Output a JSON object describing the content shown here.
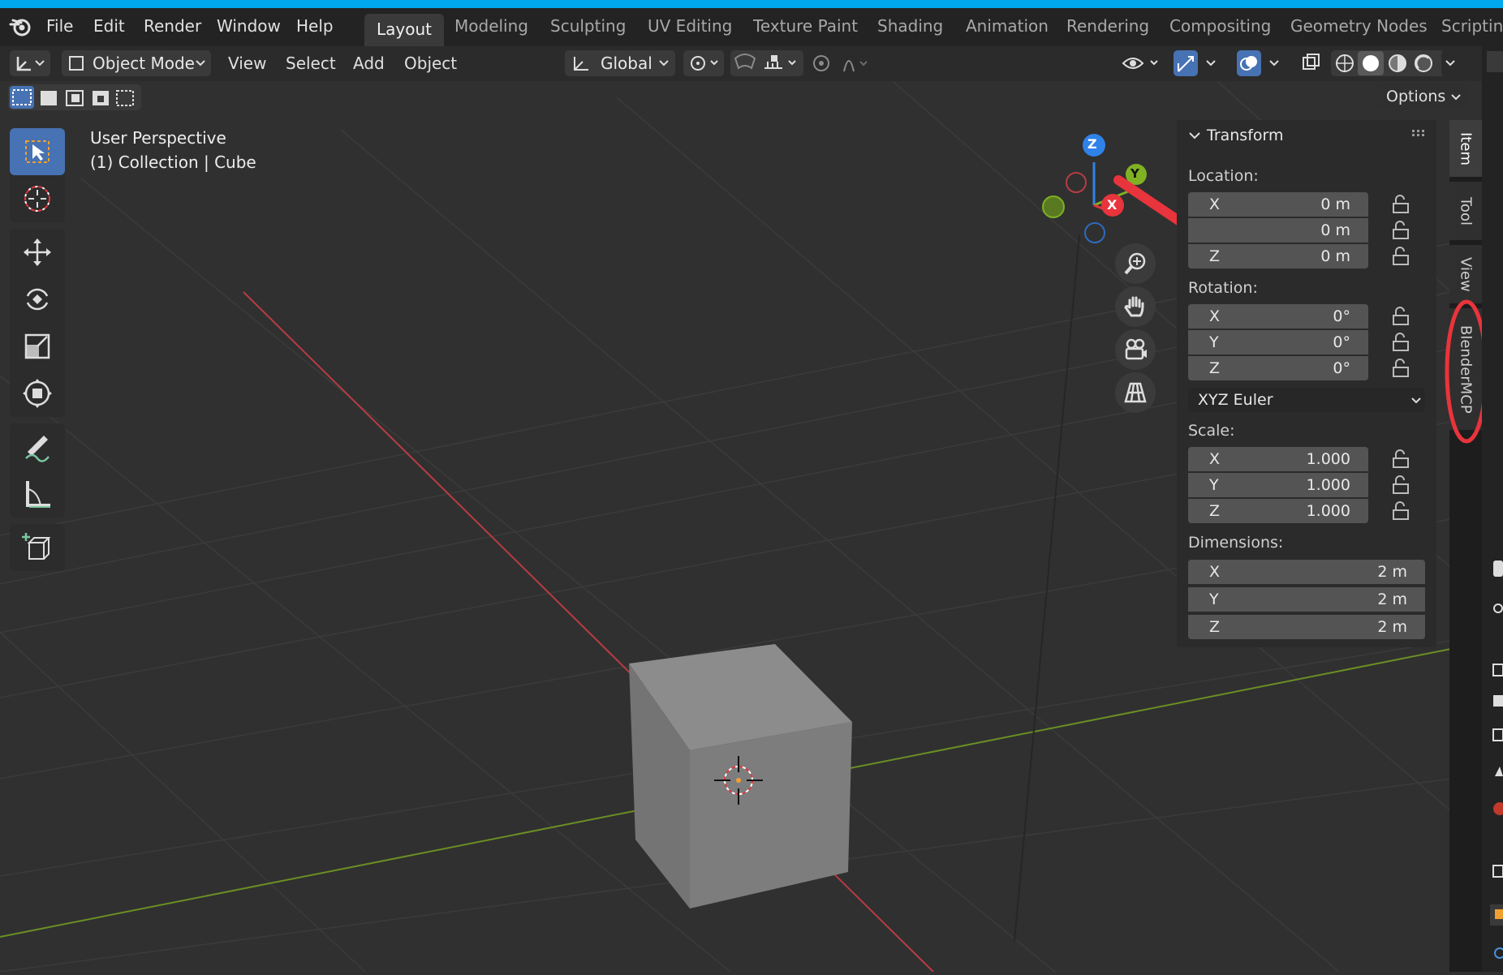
{
  "menu": {
    "file": "File",
    "edit": "Edit",
    "render": "Render",
    "window": "Window",
    "help": "Help"
  },
  "workspaces": [
    "Layout",
    "Modeling",
    "Sculpting",
    "UV Editing",
    "Texture Paint",
    "Shading",
    "Animation",
    "Rendering",
    "Compositing",
    "Geometry Nodes",
    "Scripting"
  ],
  "header": {
    "mode": "Object Mode",
    "view": "View",
    "select": "Select",
    "add": "Add",
    "object": "Object",
    "orientation": "Global",
    "options": "Options"
  },
  "overlay": {
    "perspective": "User Perspective",
    "collection": "(1) Collection | Cube"
  },
  "gizmo": {
    "x": "X",
    "y": "Y",
    "z": "Z"
  },
  "npanel": {
    "title": "Transform",
    "location_label": "Location:",
    "location": [
      {
        "axis": "X",
        "value": "0 m"
      },
      {
        "axis": "",
        "value": "0 m"
      },
      {
        "axis": "Z",
        "value": "0 m"
      }
    ],
    "rotation_label": "Rotation:",
    "rotation": [
      {
        "axis": "X",
        "value": "0°"
      },
      {
        "axis": "Y",
        "value": "0°"
      },
      {
        "axis": "Z",
        "value": "0°"
      }
    ],
    "rotation_mode": "XYZ Euler",
    "scale_label": "Scale:",
    "scale": [
      {
        "axis": "X",
        "value": "1.000"
      },
      {
        "axis": "Y",
        "value": "1.000"
      },
      {
        "axis": "Z",
        "value": "1.000"
      }
    ],
    "dimensions_label": "Dimensions:",
    "dimensions": [
      {
        "axis": "X",
        "value": "2 m"
      },
      {
        "axis": "Y",
        "value": "2 m"
      },
      {
        "axis": "Z",
        "value": "2 m"
      }
    ]
  },
  "sidetabs": [
    "Item",
    "Tool",
    "View",
    "BlenderMCP"
  ],
  "colors": {
    "accent": "#4772b3",
    "annotation": "#e8343c",
    "axis_x": "#e8343c",
    "axis_y": "#7fb123",
    "axis_z": "#2f82e8"
  }
}
